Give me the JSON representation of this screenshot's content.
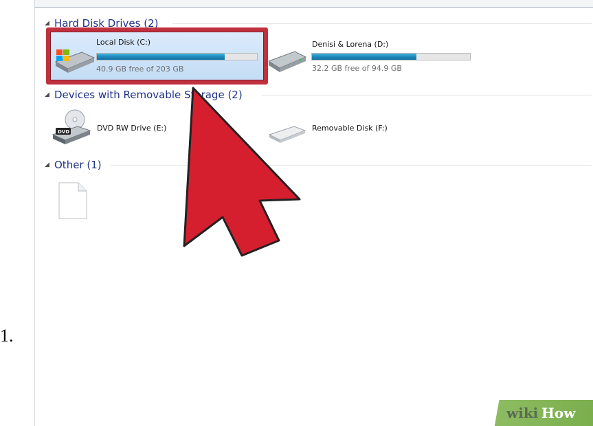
{
  "step_number": "1.",
  "explorer": {
    "groups": {
      "hard_disk": {
        "header": "Hard Disk Drives (2)",
        "drives": {
          "c": {
            "name": "Local Disk (C:)",
            "free_text": "40.9 GB free of 203 GB",
            "used_fraction": 0.8,
            "icon": "windows-hard-drive-icon",
            "selected": true
          },
          "d": {
            "name": "Denisi & Lorena (D:)",
            "free_text": "32.2 GB free of 94.9 GB",
            "used_fraction": 0.66,
            "icon": "hard-drive-icon",
            "selected": false
          }
        }
      },
      "removable": {
        "header": "Devices with Removable Storage (2)",
        "drives": {
          "e": {
            "name": "DVD RW Drive (E:)",
            "icon": "dvd-drive-icon"
          },
          "f": {
            "name": "Removable Disk (F:)",
            "icon": "removable-disk-icon"
          }
        }
      },
      "other": {
        "header": "Other (1)",
        "items": {
          "file": {
            "icon": "blank-file-icon"
          }
        }
      }
    }
  },
  "annotation": {
    "frame_color": "#c0303e",
    "arrow_color": "#d51f2f",
    "arrow_outline": "#222222"
  },
  "watermark": {
    "wiki": "wiki",
    "how": "How",
    "color": "#7aae4c"
  }
}
